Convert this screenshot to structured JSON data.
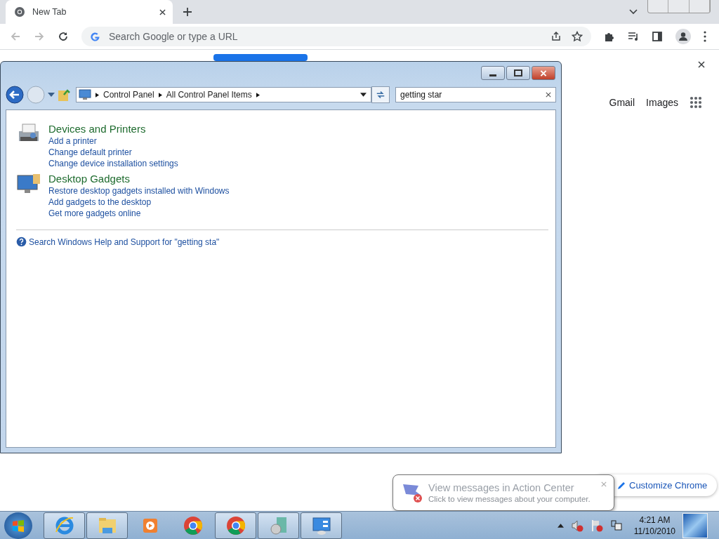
{
  "browser": {
    "tab": {
      "title": "New Tab",
      "selected": true
    },
    "search": {
      "placeholder": "Search Google or type a URL"
    },
    "links": [
      "Gmail",
      "Images"
    ],
    "customize": "Customize Chrome"
  },
  "control_panel": {
    "breadcrumb": [
      "Control Panel",
      "All Control Panel Items"
    ],
    "search": {
      "value": "getting star"
    },
    "results": [
      {
        "kind": "printer",
        "title": "Devices and Printers",
        "links": [
          "Add a printer",
          "Change default printer",
          "Change device installation settings"
        ]
      },
      {
        "kind": "gadget",
        "title": "Desktop Gadgets",
        "links": [
          "Restore desktop gadgets installed with Windows",
          "Add gadgets to the desktop",
          "Get more gadgets online"
        ]
      }
    ],
    "help_link": "Search Windows Help and Support for \"getting sta\""
  },
  "notification": {
    "title": "View messages in Action Center",
    "message": "Click to view messages about your computer."
  },
  "taskbar": {
    "apps": [
      {
        "kind": "ie",
        "running": true
      },
      {
        "kind": "explorer",
        "running": true
      },
      {
        "kind": "media",
        "running": false
      },
      {
        "kind": "chrome",
        "running": false
      },
      {
        "kind": "chrome",
        "running": true
      },
      {
        "kind": "setup",
        "running": true
      },
      {
        "kind": "gadgets",
        "running": true
      }
    ],
    "clock": {
      "time": "4:21 AM",
      "date": "11/10/2010"
    }
  }
}
